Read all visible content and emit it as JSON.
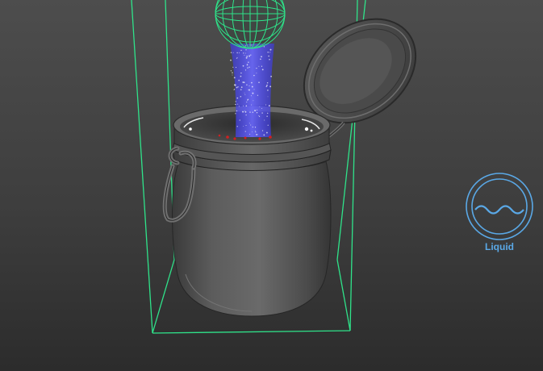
{
  "viewport": {
    "background_top": "#4d4d4d",
    "background_bottom": "#2c2c2c"
  },
  "scene": {
    "selection_color": "#2fe38a",
    "emitter_color": "#2fe38a",
    "particle_stream_color": "#3a37ff",
    "object_color": "#5e5e5e",
    "particle_hit_color": "#d02020"
  },
  "liquid_tool": {
    "label": "Liquid",
    "icon": "liquid-wave-icon",
    "color": "#5aa8e6"
  }
}
